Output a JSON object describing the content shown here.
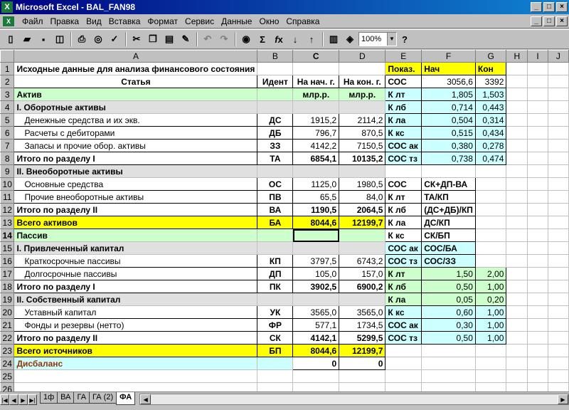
{
  "window": {
    "title": "Microsoft Excel - BAL_FAN98",
    "app_icon": "excel-icon"
  },
  "menu": [
    "Файл",
    "Правка",
    "Вид",
    "Вставка",
    "Формат",
    "Сервис",
    "Данные",
    "Окно",
    "Справка"
  ],
  "toolbar": {
    "zoom": "100%"
  },
  "columns": [
    "A",
    "B",
    "C",
    "D",
    "E",
    "F",
    "G",
    "H",
    "I",
    "J"
  ],
  "rows": [
    {
      "n": "1",
      "A": "Исходные данные для анализа финансового состояния",
      "B": "",
      "C": "",
      "D": "",
      "E": "Показ.",
      "F": "Нач",
      "G": "Кон"
    },
    {
      "n": "2",
      "A": "Статья",
      "B": "Идент",
      "C": "На нач. г.",
      "D": "На кон. г.",
      "E": "СОС",
      "F": "3056,6",
      "G": "3392"
    },
    {
      "n": "3",
      "A": "Актив",
      "B": "",
      "C": "млр.р.",
      "D": "млр.р.",
      "E": "К лт",
      "F": "1,805",
      "G": "1,503"
    },
    {
      "n": "4",
      "A": "I. Оборотные активы",
      "B": "",
      "C": "",
      "D": "",
      "E": "К лб",
      "F": "0,714",
      "G": "0,443"
    },
    {
      "n": "5",
      "A": "Денежные средства и их экв.",
      "B": "ДС",
      "C": "1915,2",
      "D": "2114,2",
      "E": "К ла",
      "F": "0,504",
      "G": "0,314"
    },
    {
      "n": "6",
      "A": "Расчеты с дебиторами",
      "B": "ДБ",
      "C": "796,7",
      "D": "870,5",
      "E": "К кс",
      "F": "0,515",
      "G": "0,434"
    },
    {
      "n": "7",
      "A": "Запасы и прочие обор. активы",
      "B": "ЗЗ",
      "C": "4142,2",
      "D": "7150,5",
      "E": "СОС ак",
      "F": "0,380",
      "G": "0,278"
    },
    {
      "n": "8",
      "A": "Итого по разделу I",
      "B": "ТА",
      "C": "6854,1",
      "D": "10135,2",
      "E": "СОС тз",
      "F": "0,738",
      "G": "0,474"
    },
    {
      "n": "9",
      "A": "II. Внеоборотные активы",
      "B": "",
      "C": "",
      "D": "",
      "E": "",
      "F": "",
      "G": ""
    },
    {
      "n": "10",
      "A": "Основные средства",
      "B": "ОС",
      "C": "1125,0",
      "D": "1980,5",
      "E": "СОС",
      "F": "СК+ДП-ВА",
      "G": ""
    },
    {
      "n": "11",
      "A": "Прочие внеоборотные активы",
      "B": "ПВ",
      "C": "65,5",
      "D": "84,0",
      "E": "К лт",
      "F": "ТА/КП",
      "G": ""
    },
    {
      "n": "12",
      "A": "Итого по разделу II",
      "B": "ВА",
      "C": "1190,5",
      "D": "2064,5",
      "E": "К лб",
      "F": "(ДС+ДБ)/КП",
      "G": ""
    },
    {
      "n": "13",
      "A": "Всего активов",
      "B": "БА",
      "C": "8044,6",
      "D": "12199,7",
      "E": "К ла",
      "F": "ДС/КП",
      "G": ""
    },
    {
      "n": "14",
      "A": "Пассив",
      "B": "",
      "C": "",
      "D": "",
      "E": "К кс",
      "F": "СК/БП",
      "G": ""
    },
    {
      "n": "15",
      "A": "I. Привлеченный капитал",
      "B": "",
      "C": "",
      "D": "",
      "E": "СОС ак",
      "F": "СОС/БА",
      "G": ""
    },
    {
      "n": "16",
      "A": "Краткосрочные пассивы",
      "B": "КП",
      "C": "3797,5",
      "D": "6743,2",
      "E": "СОС тз",
      "F": "СОС/ЗЗ",
      "G": ""
    },
    {
      "n": "17",
      "A": "Долгосрочные пассивы",
      "B": "ДП",
      "C": "105,0",
      "D": "157,0",
      "E": "К лт",
      "F": "1,50",
      "G": "2,00"
    },
    {
      "n": "18",
      "A": "Итого по разделу I",
      "B": "ПК",
      "C": "3902,5",
      "D": "6900,2",
      "E": "К лб",
      "F": "0,50",
      "G": "1,00"
    },
    {
      "n": "19",
      "A": "II. Собственный капитал",
      "B": "",
      "C": "",
      "D": "",
      "E": "К ла",
      "F": "0,05",
      "G": "0,20"
    },
    {
      "n": "20",
      "A": "Уставный капитал",
      "B": "УК",
      "C": "3565,0",
      "D": "3565,0",
      "E": "К кс",
      "F": "0,60",
      "G": "1,00"
    },
    {
      "n": "21",
      "A": "Фонды и резервы (нетто)",
      "B": "ФР",
      "C": "577,1",
      "D": "1734,5",
      "E": "СОС ак",
      "F": "0,30",
      "G": "1,00"
    },
    {
      "n": "22",
      "A": "Итого по разделу II",
      "B": "СК",
      "C": "4142,1",
      "D": "5299,5",
      "E": "СОС тз",
      "F": "0,50",
      "G": "1,00"
    },
    {
      "n": "23",
      "A": "Всего источников",
      "B": "БП",
      "C": "8044,6",
      "D": "12199,7",
      "E": "",
      "F": "",
      "G": ""
    },
    {
      "n": "24",
      "A": "Дисбаланс",
      "B": "",
      "C": "0",
      "D": "0",
      "E": "",
      "F": "",
      "G": ""
    },
    {
      "n": "25",
      "A": "",
      "B": "",
      "C": "",
      "D": "",
      "E": "",
      "F": "",
      "G": ""
    },
    {
      "n": "26",
      "A": "",
      "B": "",
      "C": "",
      "D": "",
      "E": "",
      "F": "",
      "G": ""
    }
  ],
  "sheet_tabs": [
    "1ф",
    "ВА",
    "ГА",
    "ГА (2)",
    "ФА"
  ],
  "active_tab": "ФА"
}
